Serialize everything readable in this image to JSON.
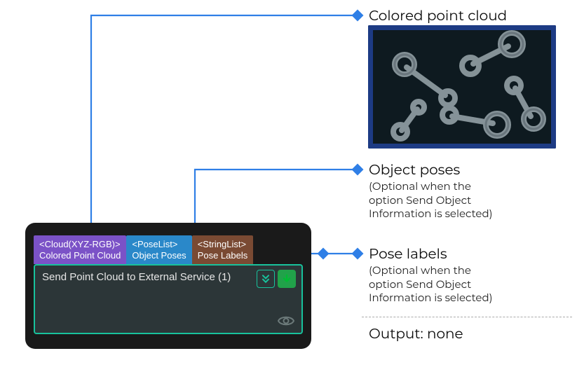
{
  "annotations": {
    "cloud": {
      "title": "Colored point cloud"
    },
    "poses": {
      "title": "Object poses",
      "sub1": "(Optional when the",
      "sub2": "option Send Object",
      "sub3": "Information is selected)"
    },
    "labels": {
      "title": "Pose labels",
      "sub1": "(Optional when the",
      "sub2": "option Send Object",
      "sub3": "Information is selected)"
    },
    "output": "Output: none"
  },
  "node": {
    "tabs": {
      "cloud": {
        "type": "<Cloud(XYZ-RGB)>",
        "name": "Colored Point Cloud"
      },
      "poses": {
        "type": "<PoseList>",
        "name": "Object Poses"
      },
      "labels": {
        "type": "<StringList>",
        "name": "Pose Labels"
      }
    },
    "title": "Send Point Cloud to External Service (1)"
  },
  "icons": {
    "chevrons": "chevrons-down-icon",
    "download": "arrow-down-icon",
    "eye": "eye-icon"
  }
}
